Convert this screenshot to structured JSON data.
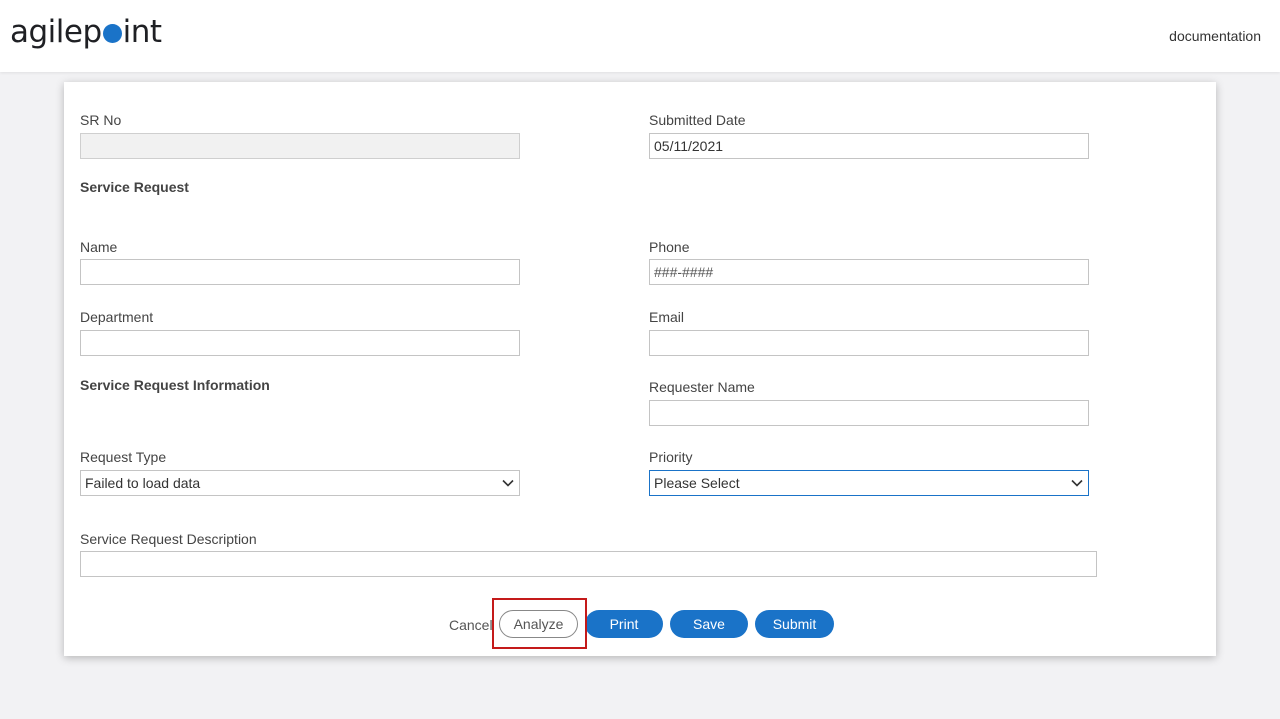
{
  "header": {
    "logo_left": "agilep",
    "logo_right": "int",
    "user_link": "documentation"
  },
  "form": {
    "sr_no": {
      "label": "SR No",
      "value": ""
    },
    "submitted_date": {
      "label": "Submitted Date",
      "value": "05/11/2021"
    },
    "section_service_request": "Service Request",
    "name": {
      "label": "Name",
      "value": ""
    },
    "phone": {
      "label": "Phone",
      "placeholder": "###-####"
    },
    "department": {
      "label": "Department",
      "value": ""
    },
    "email": {
      "label": "Email",
      "value": ""
    },
    "section_info": "Service Request Information",
    "requester_name": {
      "label": "Requester Name",
      "value": ""
    },
    "request_type": {
      "label": "Request Type",
      "value": "Failed to load data"
    },
    "priority": {
      "label": "Priority",
      "value": "Please Select"
    },
    "description": {
      "label": "Service Request Description",
      "value": ""
    }
  },
  "actions": {
    "cancel": "Cancel",
    "analyze": "Analyze",
    "print": "Print",
    "save": "Save",
    "submit": "Submit"
  },
  "colors": {
    "primary": "#1a73c8",
    "highlight": "#c41a1a"
  }
}
